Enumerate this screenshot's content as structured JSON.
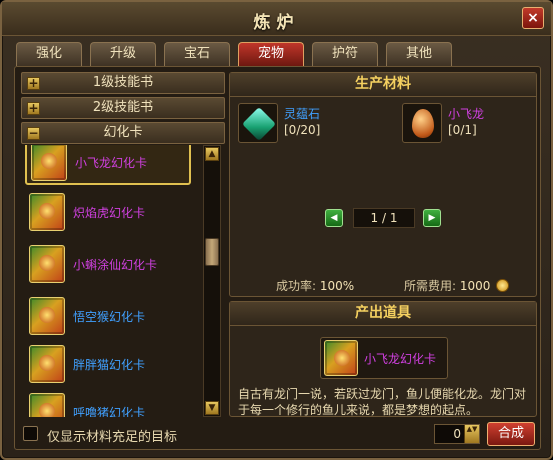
{
  "window": {
    "title": "炼炉",
    "close_icon": "×"
  },
  "tabs": [
    {
      "label": "强化",
      "active": false
    },
    {
      "label": "升级",
      "active": false
    },
    {
      "label": "宝石",
      "active": false
    },
    {
      "label": "宠物",
      "active": true
    },
    {
      "label": "护符",
      "active": false
    },
    {
      "label": "其他",
      "active": false
    }
  ],
  "categories": [
    {
      "label": "1级技能书",
      "toggle": "+"
    },
    {
      "label": "2级技能书",
      "toggle": "+"
    },
    {
      "label": "幻化卡",
      "toggle": "−"
    }
  ],
  "cards": [
    {
      "label": "小飞龙幻化卡",
      "color": "#d040e0",
      "selected": true
    },
    {
      "label": "炽焰虎幻化卡",
      "color": "#d040e0",
      "selected": false
    },
    {
      "label": "小蝌涂仙幻化卡",
      "color": "#d040e0",
      "selected": false
    },
    {
      "label": "悟空猴幻化卡",
      "color": "#40a0ff",
      "selected": false
    },
    {
      "label": "胖胖猫幻化卡",
      "color": "#40a0ff",
      "selected": false
    },
    {
      "label": "呼噜猪幻化卡",
      "color": "#40a0ff",
      "selected": false
    }
  ],
  "scrollbar": {
    "up_icon": "▲",
    "down_icon": "▼"
  },
  "filter": {
    "label": "仅显示材料充足的目标",
    "checked": false
  },
  "materials_section": {
    "title": "生产材料",
    "items": [
      {
        "name": "灵蕴石",
        "count": "[0/20]",
        "color": "#40a0ff"
      },
      {
        "name": "小飞龙",
        "count": "[0/1]",
        "color": "#d040e0"
      }
    ],
    "pager": {
      "text": "1 / 1",
      "prev_icon": "◀",
      "next_icon": "▶"
    },
    "success_label": "成功率:",
    "success_value": "100%",
    "cost_label": "所需费用:",
    "cost_value": "1000"
  },
  "output_section": {
    "title": "产出道具",
    "item_name": "小飞龙幻化卡",
    "description": "自古有龙门一说，若跃过龙门，鱼儿便能化龙。龙门对于每一个修行的鱼儿来说，都是梦想的起点。"
  },
  "quantity": {
    "value": "0",
    "spin_icon": "▲▼"
  },
  "combine_button": "合成"
}
